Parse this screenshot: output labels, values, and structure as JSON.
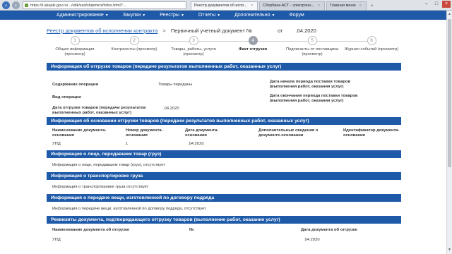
{
  "browser": {
    "address": "https://t.akupki.gov.ru/.../rdik/ssd/shipment/Infos.html?...",
    "tabs": [
      {
        "label": "Реестр документов об испо...",
        "active": true
      },
      {
        "label": "Сбербанк-АСТ - электронн...",
        "active": false
      },
      {
        "label": "Главная меню",
        "active": false
      }
    ]
  },
  "topnav": {
    "items": [
      "Администрирование",
      "Закупки",
      "Реестры",
      "Отчеты",
      "Дополнительно",
      "Форум"
    ]
  },
  "breadcrumb": {
    "link": "Реестр документов об исполнении контракта",
    "sep": ">",
    "current": "Первичный учетный документ №",
    "from": "от",
    "date": ".04.2020"
  },
  "steps": [
    {
      "num": "1",
      "label": "Общая информация (просмотр)",
      "active": false
    },
    {
      "num": "2",
      "label": "Контрагенты (просмотр)",
      "active": false
    },
    {
      "num": "3",
      "label": "Товары, работы, услуги (просмотр)",
      "active": false
    },
    {
      "num": "4",
      "label": "Факт отгрузки",
      "active": true
    },
    {
      "num": "5",
      "label": "Подписанты от поставщика (просмотр)",
      "active": false
    },
    {
      "num": "6",
      "label": "Журнал событий (просмотр)",
      "active": false
    }
  ],
  "sections": {
    "shipment": {
      "title": "Информация об отгрузке товаров (передаче результатов выполненных работ, оказанных услуг)",
      "op_content_label": "Содержание операции",
      "op_content_value": "Товары переданы",
      "op_type_label": "Вид операции",
      "ship_date_label": "Дата отгрузки товаров (передачи результатов выполненных работ, оказанных услуг)",
      "ship_date_value": ".04.2020",
      "period_start_label": "Дата начала периода поставки товаров (выполнения работ, оказания услуг)",
      "period_end_label": "Дата окончания периода поставки товаров (выполнения работ, оказания услуг)"
    },
    "basis": {
      "title": "Информация об основании отгрузки товаров (передачи результатов выполненных работ, оказанных услуг)",
      "columns": [
        "Наименование документа-основания",
        "Номер документа-основания",
        "Дата документа-основания",
        "Дополнительные сведения о документе-основании",
        "Идентификатор документа-основания"
      ],
      "row": [
        "УПД",
        "1",
        ".04.2020",
        "",
        ""
      ]
    },
    "person": {
      "title": "Информация о лице, передавшем товар (груз)",
      "text": "Информация о лице, передавшем товар (груз), отсутствует"
    },
    "transport": {
      "title": "Информация о транспортировке груза",
      "text": "Информация о транспортировке груза отсутствует"
    },
    "contract_work": {
      "title": "Информация о передаче вещи, изготовленной по договору подряда",
      "text": "Информация о передаче вещи, изготовленной по договору подряда, отсутствует"
    },
    "requisites": {
      "title": "Реквизиты документа, подтверждающего отгрузку товаров (выполнение работ, оказание услуг)",
      "col_name": "Наименование документа об отгрузке",
      "col_num": "№",
      "col_date": "Дата документа об отгрузке",
      "row_name": "УПД",
      "row_num": "",
      "row_date": ".04.2020"
    }
  }
}
